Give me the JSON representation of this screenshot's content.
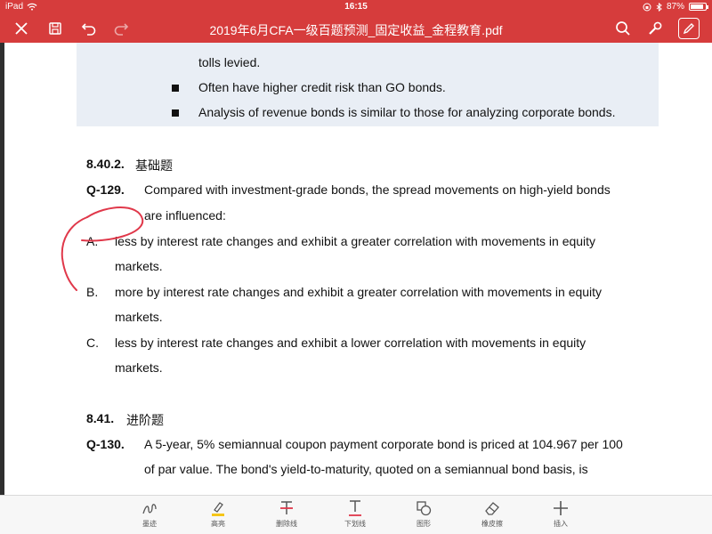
{
  "status_bar": {
    "device": "iPad",
    "time": "16:15",
    "battery_pct": "87%"
  },
  "toolbar": {
    "title": "2019年6月CFA一级百题预测_固定收益_金程教育.pdf"
  },
  "document": {
    "shaded_partial_line": "tolls levied.",
    "shaded_bullets": [
      "Often have higher credit risk than GO bonds.",
      "Analysis of revenue bonds is similar to those for analyzing corporate bonds."
    ],
    "section_1": {
      "number": "8.40.2.",
      "title": "基础题"
    },
    "q129": {
      "label": "Q-129.",
      "stem_line1": "Compared with investment-grade bonds, the spread movements on high-yield bonds",
      "stem_line2": "are influenced:",
      "options": [
        {
          "letter": "A.",
          "line1": "less by interest rate changes and exhibit a greater correlation with movements in equity",
          "line2": "markets."
        },
        {
          "letter": "B.",
          "line1": "more by interest rate changes and exhibit a greater correlation with movements in equity",
          "line2": "markets."
        },
        {
          "letter": "C.",
          "line1": "less by interest rate changes and exhibit a lower correlation with movements in equity",
          "line2": "markets."
        }
      ]
    },
    "section_2": {
      "number": "8.41.",
      "title": "进阶题"
    },
    "q130": {
      "label": "Q-130.",
      "line1": "A 5-year, 5% semiannual coupon payment corporate bond is priced at 104.967 per 100",
      "line2": "of par value. The bond's yield-to-maturity, quoted on a semiannual bond basis, is"
    }
  },
  "bottom_tools": [
    {
      "label": "墨迹",
      "icon": "ink-icon"
    },
    {
      "label": "高亮",
      "icon": "highlighter-icon"
    },
    {
      "label": "删除线",
      "icon": "strikethrough-icon"
    },
    {
      "label": "下划线",
      "icon": "underline-icon"
    },
    {
      "label": "图形",
      "icon": "shapes-icon"
    },
    {
      "label": "橡皮擦",
      "icon": "eraser-icon"
    },
    {
      "label": "插入",
      "icon": "plus-icon"
    }
  ],
  "colors": {
    "brand_red": "#d63c3c",
    "ink_red": "#e0384a",
    "highlight_yellow": "#f5c518",
    "shaded_bg": "#e9eef5"
  }
}
